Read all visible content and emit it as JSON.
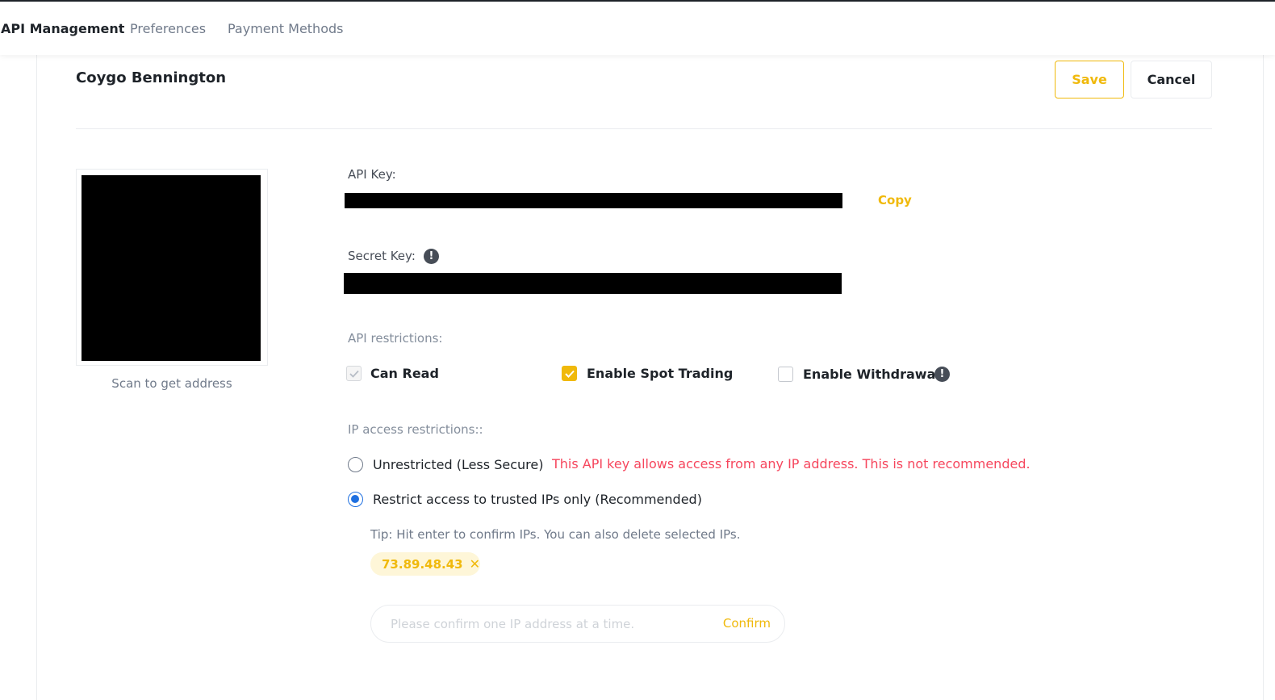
{
  "nav": {
    "tabs": [
      {
        "label": "API Management",
        "active": true
      },
      {
        "label": "Preferences",
        "active": false
      },
      {
        "label": "Payment Methods",
        "active": false
      }
    ]
  },
  "header": {
    "api_name": "Coygo Bennington",
    "save_label": "Save",
    "cancel_label": "Cancel"
  },
  "qr": {
    "caption": "Scan to get address"
  },
  "keys": {
    "api_key_label": "API Key:",
    "copy_label": "Copy",
    "secret_key_label": "Secret Key:",
    "info_glyph": "!"
  },
  "restrictions": {
    "label": "API restrictions:",
    "can_read": {
      "label": "Can Read",
      "checked": true,
      "disabled": true
    },
    "spot_trading": {
      "label": "Enable Spot Trading",
      "checked": true
    },
    "withdrawals": {
      "label": "Enable Withdrawals",
      "checked": false
    }
  },
  "ip_access": {
    "label": "IP access restrictions::",
    "unrestricted_label": "Unrestricted (Less Secure)",
    "unrestricted_warning": "This API key allows access from any IP address. This is not recommended.",
    "restricted_label": "Restrict access to trusted IPs only (Recommended)",
    "selected": "restricted",
    "tip": "Tip: Hit enter to confirm IPs. You can also delete selected IPs.",
    "ips": [
      "73.89.48.43"
    ],
    "input_placeholder": "Please confirm one IP address at a time.",
    "confirm_label": "Confirm"
  },
  "colors": {
    "accent": "#f0b90b",
    "warning": "#f6465d",
    "radio_selected": "#1e6fe0"
  }
}
